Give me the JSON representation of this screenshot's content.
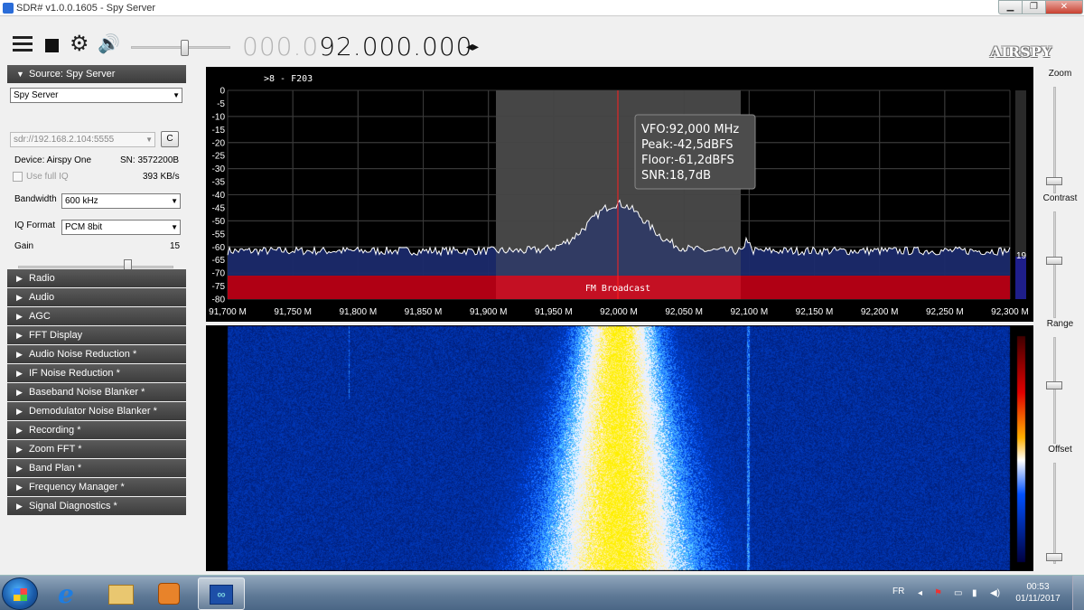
{
  "window": {
    "title": "SDR# v1.0.0.1605 - Spy Server",
    "minimize": "▁",
    "maximize": "❐",
    "close": "✕"
  },
  "toolbar": {
    "frequency_dim": "000.0",
    "frequency_main": "92.000.000",
    "freq_arrows": "◂▸",
    "logo": "AIRSPY",
    "volume_level": 0.55
  },
  "source": {
    "header": "Source: Spy Server",
    "source_type": "Spy Server",
    "uri": "sdr://192.168.2.104:5555",
    "connect_label": "C",
    "device_label": "Device: Airspy One",
    "serial_label": "SN: 3572200B",
    "full_iq_label": "Use full IQ",
    "rate": "393 KB/s",
    "bandwidth_label": "Bandwidth",
    "bandwidth_value": "600 kHz",
    "iq_format_label": "IQ Format",
    "iq_format_value": "PCM 8bit",
    "gain_label": "Gain",
    "gain_value": "15"
  },
  "plugins": [
    "Radio",
    "Audio",
    "AGC",
    "FFT Display",
    "Audio Noise Reduction *",
    "IF Noise Reduction *",
    "Baseband Noise Blanker *",
    "Demodulator Noise Blanker *",
    "Recording *",
    "Zoom FFT *",
    "Band Plan *",
    "Frequency Manager *",
    "Signal Diagnostics *"
  ],
  "spectrum": {
    "header_text": ">8 - F203",
    "y_ticks": [
      "0",
      "-5",
      "-10",
      "-15",
      "-20",
      "-25",
      "-30",
      "-35",
      "-40",
      "-45",
      "-50",
      "-55",
      "-60",
      "-65",
      "-70",
      "-75",
      "-80"
    ],
    "x_ticks": [
      "91,700 M",
      "91,750 M",
      "91,800 M",
      "91,850 M",
      "91,900 M",
      "91,950 M",
      "92,000 M",
      "92,050 M",
      "92,100 M",
      "92,150 M",
      "92,200 M",
      "92,250 M",
      "92,300 M"
    ],
    "band_label": "FM Broadcast",
    "tooltip": {
      "vfo": "VFO:92,000 MHz",
      "peak": "Peak:-42,5dBFS",
      "floor": "Floor:-61,2dBFS",
      "snr": "SNR:18,7dB"
    },
    "level_value": "19",
    "colors": {
      "band": "#b00014",
      "fill": "#1b2a6b",
      "passband": "#3c3c3c",
      "vfo_line": "#ff2020"
    }
  },
  "right": {
    "zoom": "Zoom",
    "contrast": "Contrast",
    "range": "Range",
    "offset": "Offset"
  },
  "taskbar": {
    "lang": "FR",
    "time": "00:53",
    "date": "01/11/2017",
    "app_sdr_glyph": "∞"
  }
}
